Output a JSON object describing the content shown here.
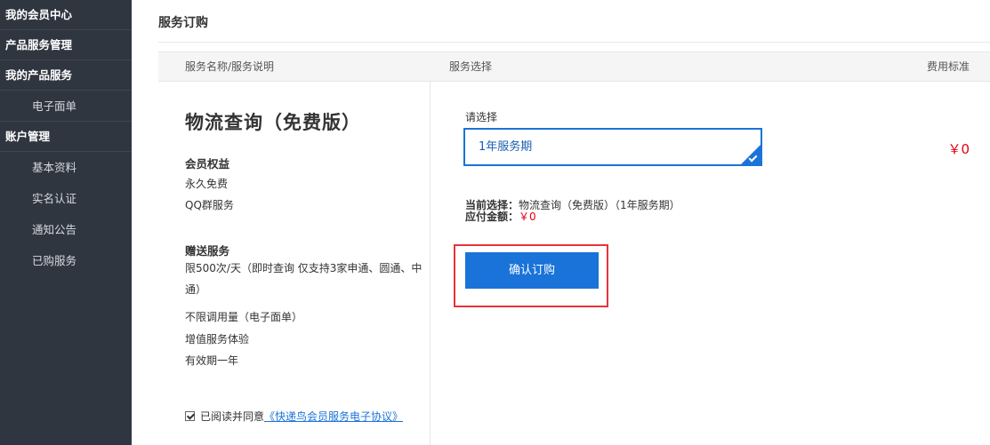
{
  "sidebar": {
    "groups": [
      {
        "label": "我的会员中心"
      },
      {
        "label": "产品服务管理"
      },
      {
        "label": "我的产品服务"
      },
      {
        "label": "账户管理"
      }
    ],
    "items": [
      {
        "label": "电子面单"
      },
      {
        "label": "基本资料"
      },
      {
        "label": "实名认证"
      },
      {
        "label": "通知公告"
      },
      {
        "label": "已购服务"
      }
    ]
  },
  "page": {
    "title": "服务订购"
  },
  "table": {
    "headers": [
      "服务名称/服务说明",
      "服务选择",
      "费用标准"
    ]
  },
  "service": {
    "name": "物流查询（免费版）",
    "benefits_title": "会员权益",
    "benefits": [
      "永久免费",
      "QQ群服务"
    ],
    "gift_title": "赠送服务",
    "gift_lines": [
      "限500次/天（即时查询 仅支持3家申通、圆通、中通）",
      "不限调用量（电子面单）",
      "增值服务体验",
      "有效期一年"
    ]
  },
  "agreement": {
    "text": "已阅读并同意",
    "link": "《快递鸟会员服务电子协议》",
    "checked": true
  },
  "selection": {
    "label": "请选择",
    "value": "1年服务期",
    "current_label": "当前选择：",
    "current_value": "物流查询（免费版）（1年服务期）",
    "amount_label": "应付金额：",
    "amount_value": "￥0"
  },
  "actions": {
    "confirm": "确认订购"
  },
  "price": "￥0",
  "colors": {
    "sidebar_bg": "#2f3640",
    "accent": "#1a73d9",
    "price": "#e60012",
    "highlight": "#e8333a"
  }
}
